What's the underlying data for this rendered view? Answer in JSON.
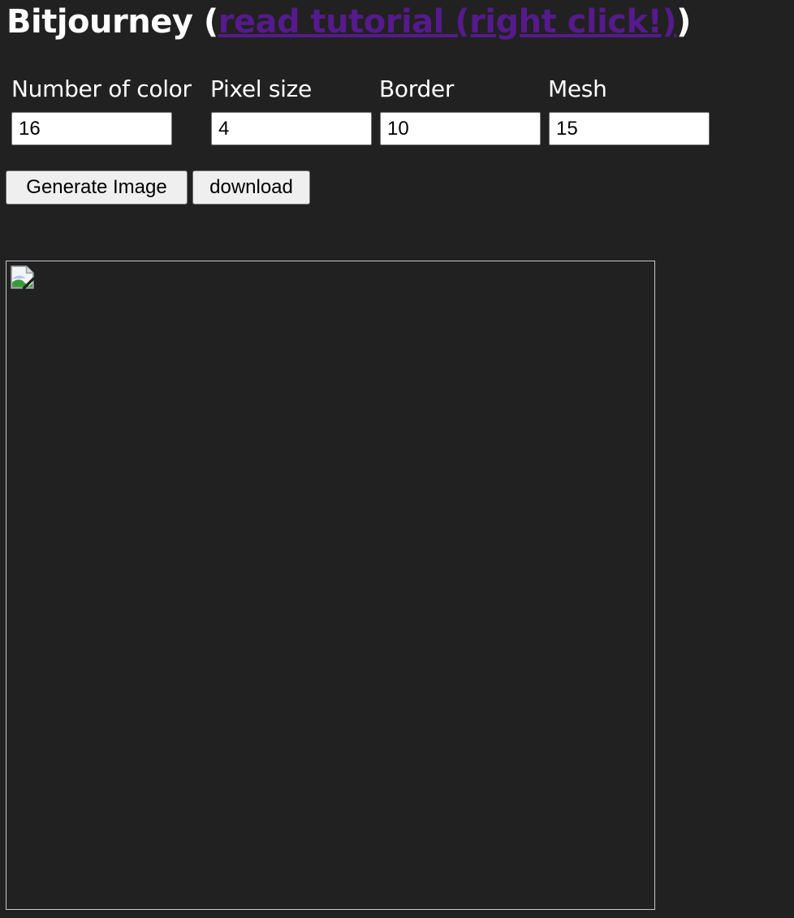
{
  "header": {
    "title": "Bitjourney",
    "open_paren": " (",
    "link_label": "read tutorial (right click!)",
    "close_paren": ")",
    "link_color": "#551a8b"
  },
  "fields": [
    {
      "label": "Number of color",
      "value": "16"
    },
    {
      "label": "Pixel size",
      "value": "4"
    },
    {
      "label": "Border",
      "value": "10"
    },
    {
      "label": "Mesh",
      "value": "15"
    }
  ],
  "buttons": {
    "generate_label": "Generate Image",
    "download_label": "download"
  },
  "preview": {
    "icon": "broken-image-icon"
  },
  "colors": {
    "background": "#212121",
    "text": "#ffffff",
    "frame_border": "#c8c8c8"
  }
}
